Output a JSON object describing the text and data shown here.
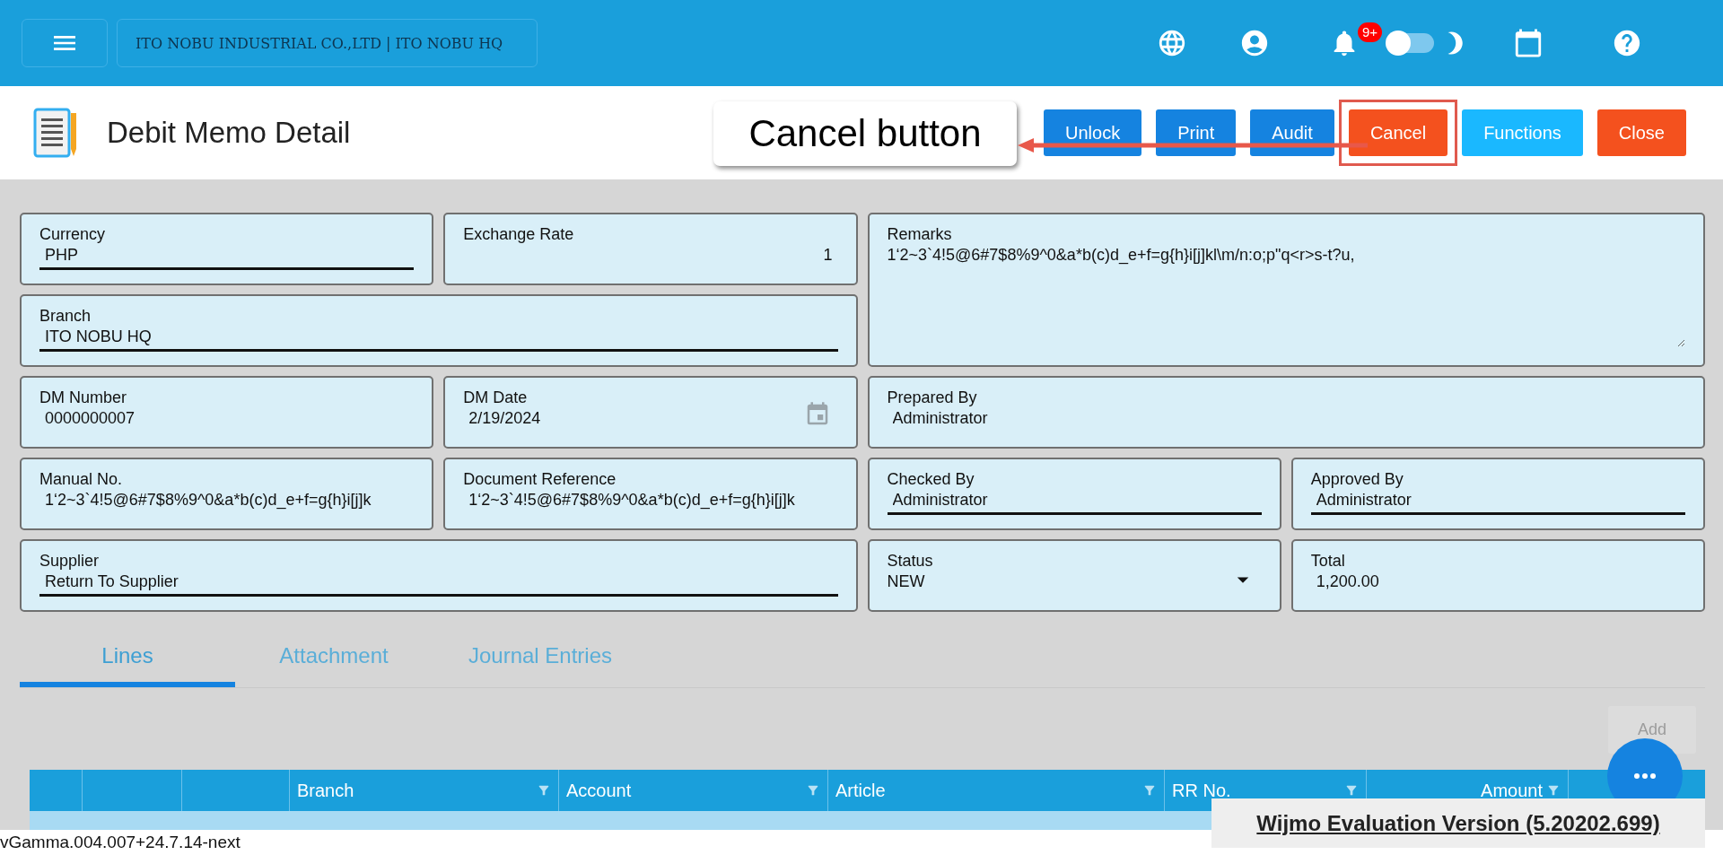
{
  "top_bar": {
    "company": "ITO NOBU INDUSTRIAL CO.,LTD | ITO NOBU HQ",
    "notification_badge": "9+",
    "dark_mode": false
  },
  "header": {
    "title": "Debit Memo Detail",
    "buttons": [
      {
        "label": "Unlock",
        "color": "#1583e0",
        "highlighted": false
      },
      {
        "label": "Print",
        "color": "#1583e0",
        "highlighted": false
      },
      {
        "label": "Audit",
        "color": "#1583e0",
        "highlighted": false
      },
      {
        "label": "Cancel",
        "color": "#f4511e",
        "highlighted": true
      },
      {
        "label": "Functions",
        "color": "#1ab8ff",
        "highlighted": false
      },
      {
        "label": "Close",
        "color": "#f4511e",
        "highlighted": false
      }
    ],
    "callout": "Cancel button"
  },
  "form": [
    {
      "label": "Currency",
      "value": "PHP",
      "kind": "text",
      "lookup": true
    },
    {
      "label": "Exchange Rate",
      "value": "1",
      "kind": "number",
      "lookup": false
    },
    {
      "label": "Remarks",
      "value": "1‘2~3`4!5@6#7$8%9^0&a*b(c)d_e+f=g{h}i[j]kl\\m/n:o;p\"q<r>s-t?u,",
      "kind": "textarea",
      "lookup": false
    },
    {
      "label": "Branch",
      "value": "ITO NOBU HQ",
      "kind": "text",
      "lookup": true
    },
    {
      "label": "DM Number",
      "value": "0000000007",
      "kind": "text",
      "lookup": false
    },
    {
      "label": "DM Date",
      "value": "2/19/2024",
      "kind": "date",
      "lookup": false
    },
    {
      "label": "Prepared By",
      "value": "Administrator",
      "kind": "text",
      "lookup": false
    },
    {
      "label": "Manual No.",
      "value": "1‘2~3`4!5@6#7$8%9^0&a*b(c)d_e+f=g{h}i[j]k",
      "kind": "text",
      "lookup": false
    },
    {
      "label": "Document Reference",
      "value": "1‘2~3`4!5@6#7$8%9^0&a*b(c)d_e+f=g{h}i[j]k",
      "kind": "text",
      "lookup": false
    },
    {
      "label": "Checked By",
      "value": "Administrator",
      "kind": "text",
      "lookup": true
    },
    {
      "label": "Approved By",
      "value": "Administrator",
      "kind": "text",
      "lookup": true
    },
    {
      "label": "Supplier",
      "value": "Return To Supplier",
      "kind": "text",
      "lookup": true
    },
    {
      "label": "Status",
      "value": "NEW",
      "kind": "select",
      "lookup": false
    },
    {
      "label": "Total",
      "value": "1,200.00",
      "kind": "text",
      "lookup": false
    }
  ],
  "tabs": [
    {
      "label": "Lines",
      "selected": true
    },
    {
      "label": "Attachment",
      "selected": false
    },
    {
      "label": "Journal Entries",
      "selected": false
    }
  ],
  "add_button": {
    "label": "Add",
    "disabled": true
  },
  "table": {
    "columns": [
      "Branch",
      "Account",
      "Article",
      "RR No.",
      "Amount"
    ]
  },
  "footer": {
    "version": "vGamma.004.007+24.7.14-next",
    "notice": "Wijmo Evaluation Version (5.20202.699)"
  }
}
